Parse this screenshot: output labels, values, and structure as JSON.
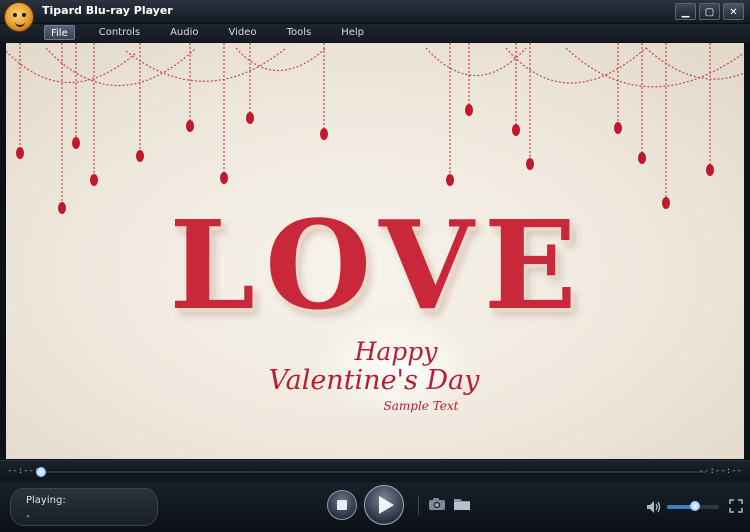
{
  "window": {
    "title": "Tipard Blu-ray Player"
  },
  "menu": {
    "items": [
      "File",
      "Controls",
      "Audio",
      "Video",
      "Tools",
      "Help"
    ],
    "active": "File"
  },
  "video": {
    "headline": "LOVE",
    "line1": "Happy",
    "line2": "Valentine's Day",
    "line3": "Sample Text"
  },
  "seek": {
    "elapsed": "--:--:--",
    "total": "--:--:--",
    "progress": 0.0
  },
  "status": {
    "label": "Playing:",
    "value": "-"
  },
  "volume": {
    "level": 0.52
  },
  "colors": {
    "accent": "#3c7fc4",
    "bg": "#0d1219",
    "love": "#c8283a"
  },
  "icons": [
    "app-logo-icon",
    "minimize-icon",
    "maximize-icon",
    "close-icon",
    "stop-icon",
    "play-icon",
    "camera-icon",
    "folder-icon",
    "volume-icon",
    "fullscreen-icon"
  ]
}
